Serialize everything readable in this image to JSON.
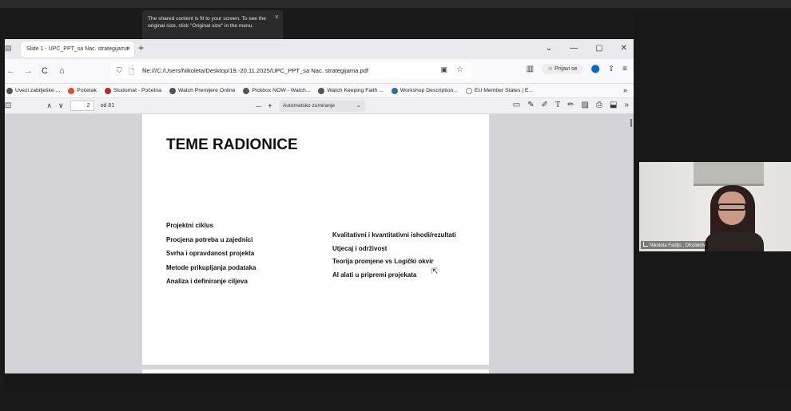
{
  "tooltip": {
    "text": "The shared content is fit to your screen. To see the original size, click \"Original size\" in the menu.",
    "close": "×"
  },
  "browser": {
    "tab": {
      "title": "Slide 1 - UPC_PPT_sa Nac. strategijama",
      "close": "×"
    },
    "new_tab": "+",
    "window_controls": [
      "⌄",
      "—",
      "▢",
      "✕"
    ],
    "nav": {
      "back": "←",
      "forward": "→",
      "reload": "C",
      "home": "⌂"
    },
    "url": "file:///C:/Users/Nikoleta/Desktop/19.-20.11.2025/UPC_PPT_sa Nac. strategijama.pdf",
    "signin": "Prijavi se",
    "bookmarks": [
      {
        "label": "Uvezi zabilješke ...",
        "color": "#444444"
      },
      {
        "label": "Početak",
        "color": "#e04c2a"
      },
      {
        "label": "Studomat - Početna",
        "color": "#b52a2a"
      },
      {
        "label": "Watch Premijere Online",
        "color": "#333333"
      },
      {
        "label": "Pickbox NOW - Watch...",
        "color": "#333333"
      },
      {
        "label": "Watch Keeping Faith ...",
        "color": "#333333"
      },
      {
        "label": "Workshop Description...",
        "color": "#21759b"
      },
      {
        "label": "EU Member States | E...",
        "color": "#888888"
      }
    ],
    "bookmarks_more": "»"
  },
  "pdf": {
    "page_current": "2",
    "page_total": "od 81",
    "zoom": "Automatsko zumiranje",
    "zoom_minus": "—",
    "zoom_plus": "+",
    "title": "TEME RADIONICE",
    "left_items": [
      "Projektni ciklus",
      "Procjena potreba u zajednici",
      "Svrha i opravdanost projekta",
      "Metode prikupljanja podataka",
      "Analiza i definiranje ciljeva"
    ],
    "right_items": [
      "Kvalitativni i kvantitativni ishodi/rezultati",
      "Utjecaj i održivost",
      "Teorija promjene vs Logički okvir",
      "AI alati u pripremi projekata"
    ]
  },
  "video": {
    "participant_name": "Nikoleta Fadljo , DKolektiv"
  }
}
